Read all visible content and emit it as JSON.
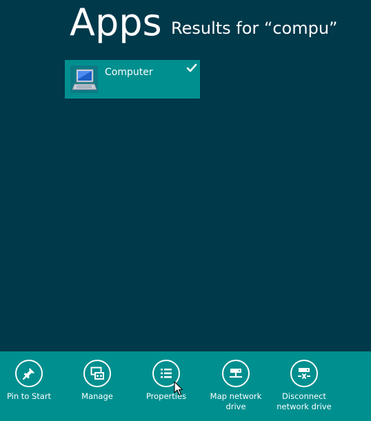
{
  "header": {
    "title": "Apps",
    "results_label": "Results for “compu”"
  },
  "results": [
    {
      "label": "Computer",
      "icon": "computer-icon",
      "selected": true
    }
  ],
  "app_bar": {
    "commands": [
      {
        "label": "Pin to Start",
        "icon": "pin-icon"
      },
      {
        "label": "Manage",
        "icon": "manage-icon"
      },
      {
        "label": "Properties",
        "icon": "properties-icon"
      },
      {
        "label": "Map network\ndrive",
        "icon": "map-network-drive-icon"
      },
      {
        "label": "Disconnect\nnetwork drive",
        "icon": "disconnect-network-drive-icon"
      }
    ]
  },
  "colors": {
    "background": "#00394A",
    "accent": "#008F8F"
  }
}
